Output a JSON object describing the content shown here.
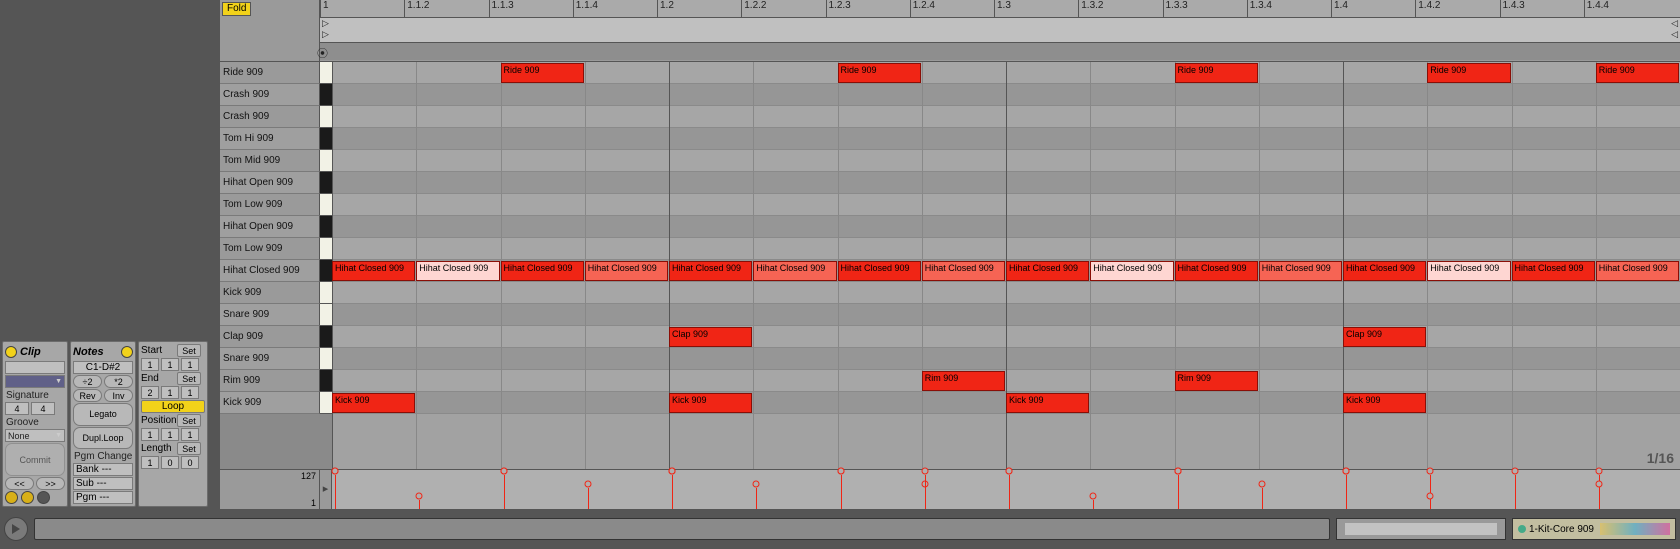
{
  "clip_panel": {
    "title": "Clip",
    "signature_label": "Signature",
    "sig_num": "4",
    "sig_den": "4",
    "groove_label": "Groove",
    "groove_value": "None",
    "commit": "Commit",
    "nudge_back": "<<",
    "nudge_fwd": ">>"
  },
  "notes_panel": {
    "title": "Notes",
    "range": "C1-D#2",
    "div2": "÷2",
    "mul2": "*2",
    "rev": "Rev",
    "inv": "Inv",
    "legato": "Legato",
    "dupl": "Dupl.Loop",
    "pgm_change": "Pgm Change",
    "bank": "Bank ---",
    "sub": "Sub ---",
    "pgm": "Pgm ---"
  },
  "loop_panel": {
    "start_lbl": "Start",
    "set": "Set",
    "start_bar": "1",
    "start_beat": "1",
    "start_six": "1",
    "end_lbl": "End",
    "end_bar": "2",
    "end_beat": "1",
    "end_six": "1",
    "loop_lbl": "Loop",
    "pos_lbl": "Position",
    "pos_bar": "1",
    "pos_beat": "1",
    "pos_six": "1",
    "len_lbl": "Length",
    "len_bar": "1",
    "len_beat": "0",
    "len_six": "0"
  },
  "fold": "Fold",
  "ruler_ticks": [
    "1",
    "1.1.2",
    "1.1.3",
    "1.1.4",
    "1.2",
    "1.2.2",
    "1.2.3",
    "1.2.4",
    "1.3",
    "1.3.2",
    "1.3.3",
    "1.3.4",
    "1.4",
    "1.4.2",
    "1.4.3",
    "1.4.4"
  ],
  "lanes": [
    {
      "name": "Ride 909",
      "key": "w"
    },
    {
      "name": "Crash 909",
      "key": "b"
    },
    {
      "name": "Crash 909",
      "key": "w"
    },
    {
      "name": "Tom Hi 909",
      "key": "b"
    },
    {
      "name": "Tom Mid 909",
      "key": "w"
    },
    {
      "name": "Hihat Open 909",
      "key": "b"
    },
    {
      "name": "Tom Low 909",
      "key": "w"
    },
    {
      "name": "Hihat Open 909",
      "key": "b"
    },
    {
      "name": "Tom Low 909",
      "key": "w"
    },
    {
      "name": "Hihat Closed 909",
      "key": "b"
    },
    {
      "name": "Kick 909",
      "key": "w"
    },
    {
      "name": "Snare 909",
      "key": "w"
    },
    {
      "name": "Clap 909",
      "key": "b"
    },
    {
      "name": "Snare 909",
      "key": "w"
    },
    {
      "name": "Rim 909",
      "key": "b"
    },
    {
      "name": "Kick 909",
      "key": "w"
    }
  ],
  "notes": [
    {
      "lane": 0,
      "step": 2,
      "len": 1,
      "label": "Ride 909",
      "vel": 127
    },
    {
      "lane": 0,
      "step": 6,
      "len": 1,
      "label": "Ride 909",
      "vel": 127
    },
    {
      "lane": 0,
      "step": 10,
      "len": 1,
      "label": "Ride 909",
      "vel": 127
    },
    {
      "lane": 0,
      "step": 13,
      "len": 1,
      "label": "Ride 909",
      "vel": 127
    },
    {
      "lane": 0,
      "step": 15,
      "len": 1,
      "label": "Ride 909",
      "vel": 127
    },
    {
      "lane": 9,
      "step": 0,
      "len": 1,
      "label": "Hihat Closed 909",
      "vel": 127
    },
    {
      "lane": 9,
      "step": 1,
      "len": 1,
      "label": "Hihat Closed 909",
      "vel": 35,
      "dim": 3
    },
    {
      "lane": 9,
      "step": 2,
      "len": 1,
      "label": "Hihat Closed 909",
      "vel": 127
    },
    {
      "lane": 9,
      "step": 3,
      "len": 1,
      "label": "Hihat Closed 909",
      "vel": 80,
      "dim": 1
    },
    {
      "lane": 9,
      "step": 4,
      "len": 1,
      "label": "Hihat Closed 909",
      "vel": 127
    },
    {
      "lane": 9,
      "step": 5,
      "len": 1,
      "label": "Hihat Closed 909",
      "vel": 80,
      "dim": 1
    },
    {
      "lane": 9,
      "step": 6,
      "len": 1,
      "label": "Hihat Closed 909",
      "vel": 127
    },
    {
      "lane": 9,
      "step": 7,
      "len": 1,
      "label": "Hihat Closed 909",
      "vel": 80,
      "dim": 1
    },
    {
      "lane": 9,
      "step": 8,
      "len": 1,
      "label": "Hihat Closed 909",
      "vel": 127
    },
    {
      "lane": 9,
      "step": 9,
      "len": 1,
      "label": "Hihat Closed 909",
      "vel": 35,
      "dim": 3
    },
    {
      "lane": 9,
      "step": 10,
      "len": 1,
      "label": "Hihat Closed 909",
      "vel": 127
    },
    {
      "lane": 9,
      "step": 11,
      "len": 1,
      "label": "Hihat Closed 909",
      "vel": 80,
      "dim": 1
    },
    {
      "lane": 9,
      "step": 12,
      "len": 1,
      "label": "Hihat Closed 909",
      "vel": 127
    },
    {
      "lane": 9,
      "step": 13,
      "len": 1,
      "label": "Hihat Closed 909",
      "vel": 35,
      "dim": 3
    },
    {
      "lane": 9,
      "step": 14,
      "len": 1,
      "label": "Hihat Closed 909",
      "vel": 127
    },
    {
      "lane": 9,
      "step": 15,
      "len": 1,
      "label": "Hihat Closed 909",
      "vel": 80,
      "dim": 1
    },
    {
      "lane": 12,
      "step": 4,
      "len": 1,
      "label": "Clap 909",
      "vel": 127
    },
    {
      "lane": 12,
      "step": 12,
      "len": 1,
      "label": "Clap 909",
      "vel": 127
    },
    {
      "lane": 14,
      "step": 7,
      "len": 1,
      "label": "Rim 909",
      "vel": 127
    },
    {
      "lane": 14,
      "step": 10,
      "len": 1,
      "label": "Rim 909",
      "vel": 127
    },
    {
      "lane": 15,
      "step": 0,
      "len": 1,
      "label": "Kick 909",
      "vel": 127
    },
    {
      "lane": 15,
      "step": 4,
      "len": 1,
      "label": "Kick 909",
      "vel": 127
    },
    {
      "lane": 15,
      "step": 8,
      "len": 1,
      "label": "Kick 909",
      "vel": 127
    },
    {
      "lane": 15,
      "step": 12,
      "len": 1,
      "label": "Kick 909",
      "vel": 127
    }
  ],
  "velocity_max": "127",
  "velocity_min": "1",
  "grid_label": "1/16",
  "device_name": "1-Kit-Core 909"
}
